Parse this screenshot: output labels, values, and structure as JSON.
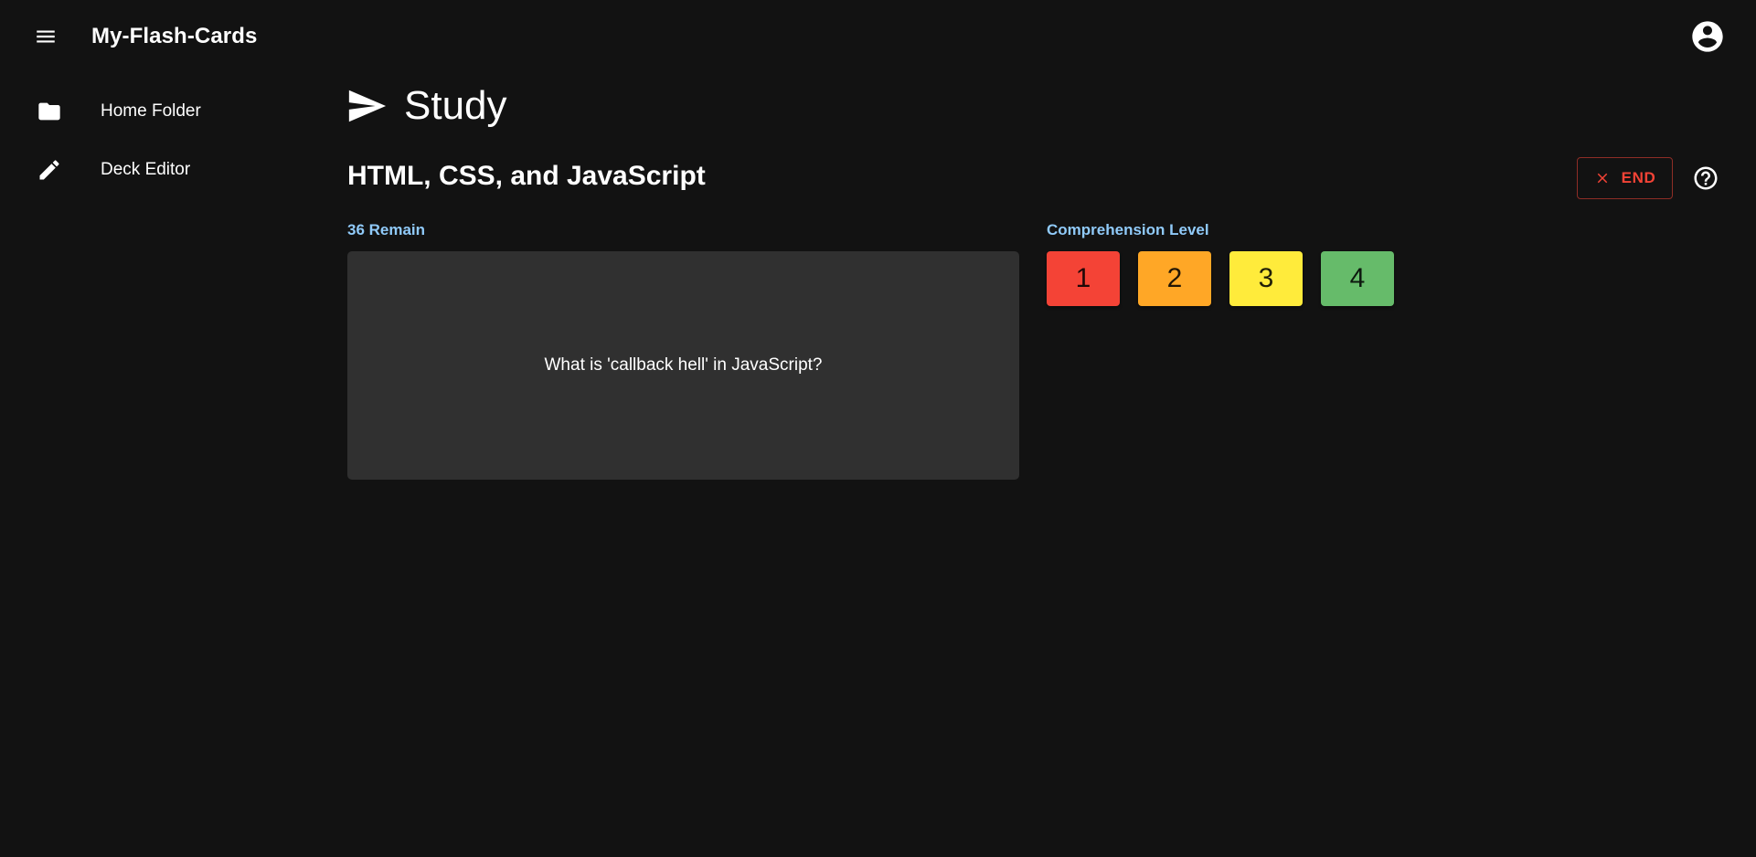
{
  "app": {
    "title": "My-Flash-Cards"
  },
  "sidebar": {
    "items": [
      {
        "label": "Home Folder",
        "icon": "folder-icon"
      },
      {
        "label": "Deck Editor",
        "icon": "pencil-icon"
      }
    ]
  },
  "page": {
    "title": "Study",
    "icon": "send-icon"
  },
  "deck": {
    "title": "HTML, CSS, and JavaScript",
    "end_label": "END",
    "remain_label": "36 Remain",
    "question": "What is 'callback hell' in JavaScript?"
  },
  "comprehension": {
    "label": "Comprehension Level",
    "levels": [
      {
        "label": "1",
        "color": "#f44336"
      },
      {
        "label": "2",
        "color": "#ffa726"
      },
      {
        "label": "3",
        "color": "#ffeb3b"
      },
      {
        "label": "4",
        "color": "#66bb6a"
      }
    ]
  },
  "colors": {
    "background": "#121212",
    "card": "#303030",
    "accent_blue": "#90caf9",
    "danger": "#f44336"
  }
}
